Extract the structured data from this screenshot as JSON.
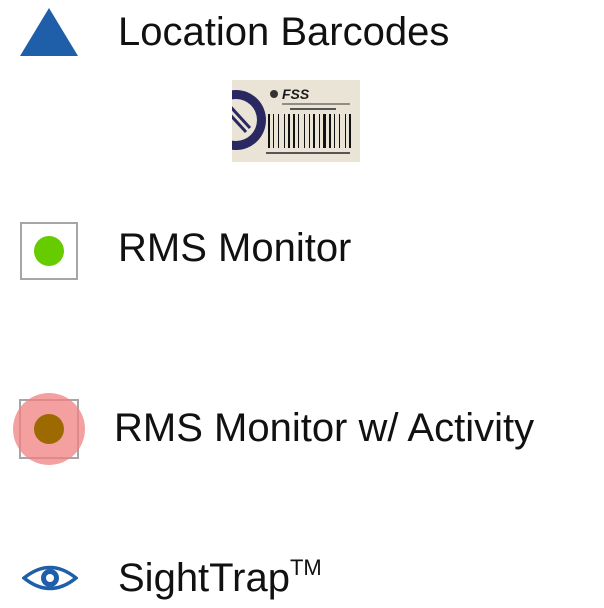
{
  "legend": {
    "items": [
      {
        "id": "location-barcodes",
        "label": "Location Barcodes",
        "icon": "blue-triangle-icon",
        "color": "#1f5faa",
        "barcode_sample": {
          "brand": "FSS"
        }
      },
      {
        "id": "rms-monitor",
        "label": "RMS Monitor",
        "icon": "green-dot-square-icon",
        "color": "#66cc00"
      },
      {
        "id": "rms-monitor-activity",
        "label": "RMS Monitor w/ Activity",
        "icon": "brown-dot-red-halo-icon",
        "color": "#9c6a00",
        "halo_color": "#f08080"
      },
      {
        "id": "sighttrap",
        "label": "SightTrap",
        "label_superscript": "TM",
        "icon": "eye-icon",
        "color": "#1f5faa"
      }
    ]
  }
}
